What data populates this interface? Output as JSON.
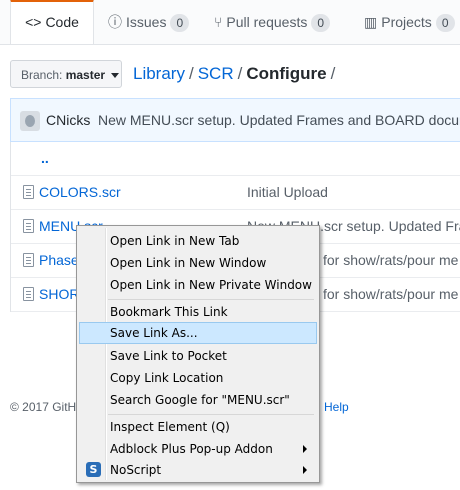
{
  "tabs": [
    {
      "label": "Code",
      "icon": "code-icon"
    },
    {
      "label": "Issues",
      "count": "0",
      "icon": "issue-icon"
    },
    {
      "label": "Pull requests",
      "count": "0",
      "icon": "pull-request-icon"
    },
    {
      "label": "Projects",
      "count": "0",
      "icon": "project-icon"
    }
  ],
  "branch": {
    "prefix": "Branch:",
    "name": "master"
  },
  "breadcrumb": {
    "root": "Library",
    "dir": "SCR",
    "current": "Configure",
    "sep": "/"
  },
  "commit": {
    "author": "CNicks",
    "message": "New MENU.scr setup. Updated Frames and BOARD documentati"
  },
  "files": {
    "up": "..",
    "rows": [
      {
        "name": "COLORS.scr",
        "message": "Initial Upload"
      },
      {
        "name": "MENU.scr",
        "message": "New MENU.scr setup. Updated Fram"
      },
      {
        "name": "Phase",
        "message": "for show/rats/pour me"
      },
      {
        "name": "SHOR",
        "message": "for show/rats/pour me"
      }
    ]
  },
  "footer": {
    "copyright": "© 2017 GitH",
    "help": "Help"
  },
  "context_menu": {
    "items": [
      {
        "label": "Open Link in New Tab"
      },
      {
        "label": "Open Link in New Window"
      },
      {
        "label": "Open Link in New Private Window"
      },
      {
        "label": "Bookmark This Link"
      },
      {
        "label": "Save Link As..."
      },
      {
        "label": "Save Link to Pocket"
      },
      {
        "label": "Copy Link Location"
      },
      {
        "label": "Search Google for \"MENU.scr\""
      },
      {
        "label": "Inspect Element (Q)"
      },
      {
        "label": "Adblock Plus Pop-up Addon"
      },
      {
        "label": "NoScript",
        "icon_letter": "S"
      }
    ],
    "highlight_color": "#cce8ff"
  }
}
